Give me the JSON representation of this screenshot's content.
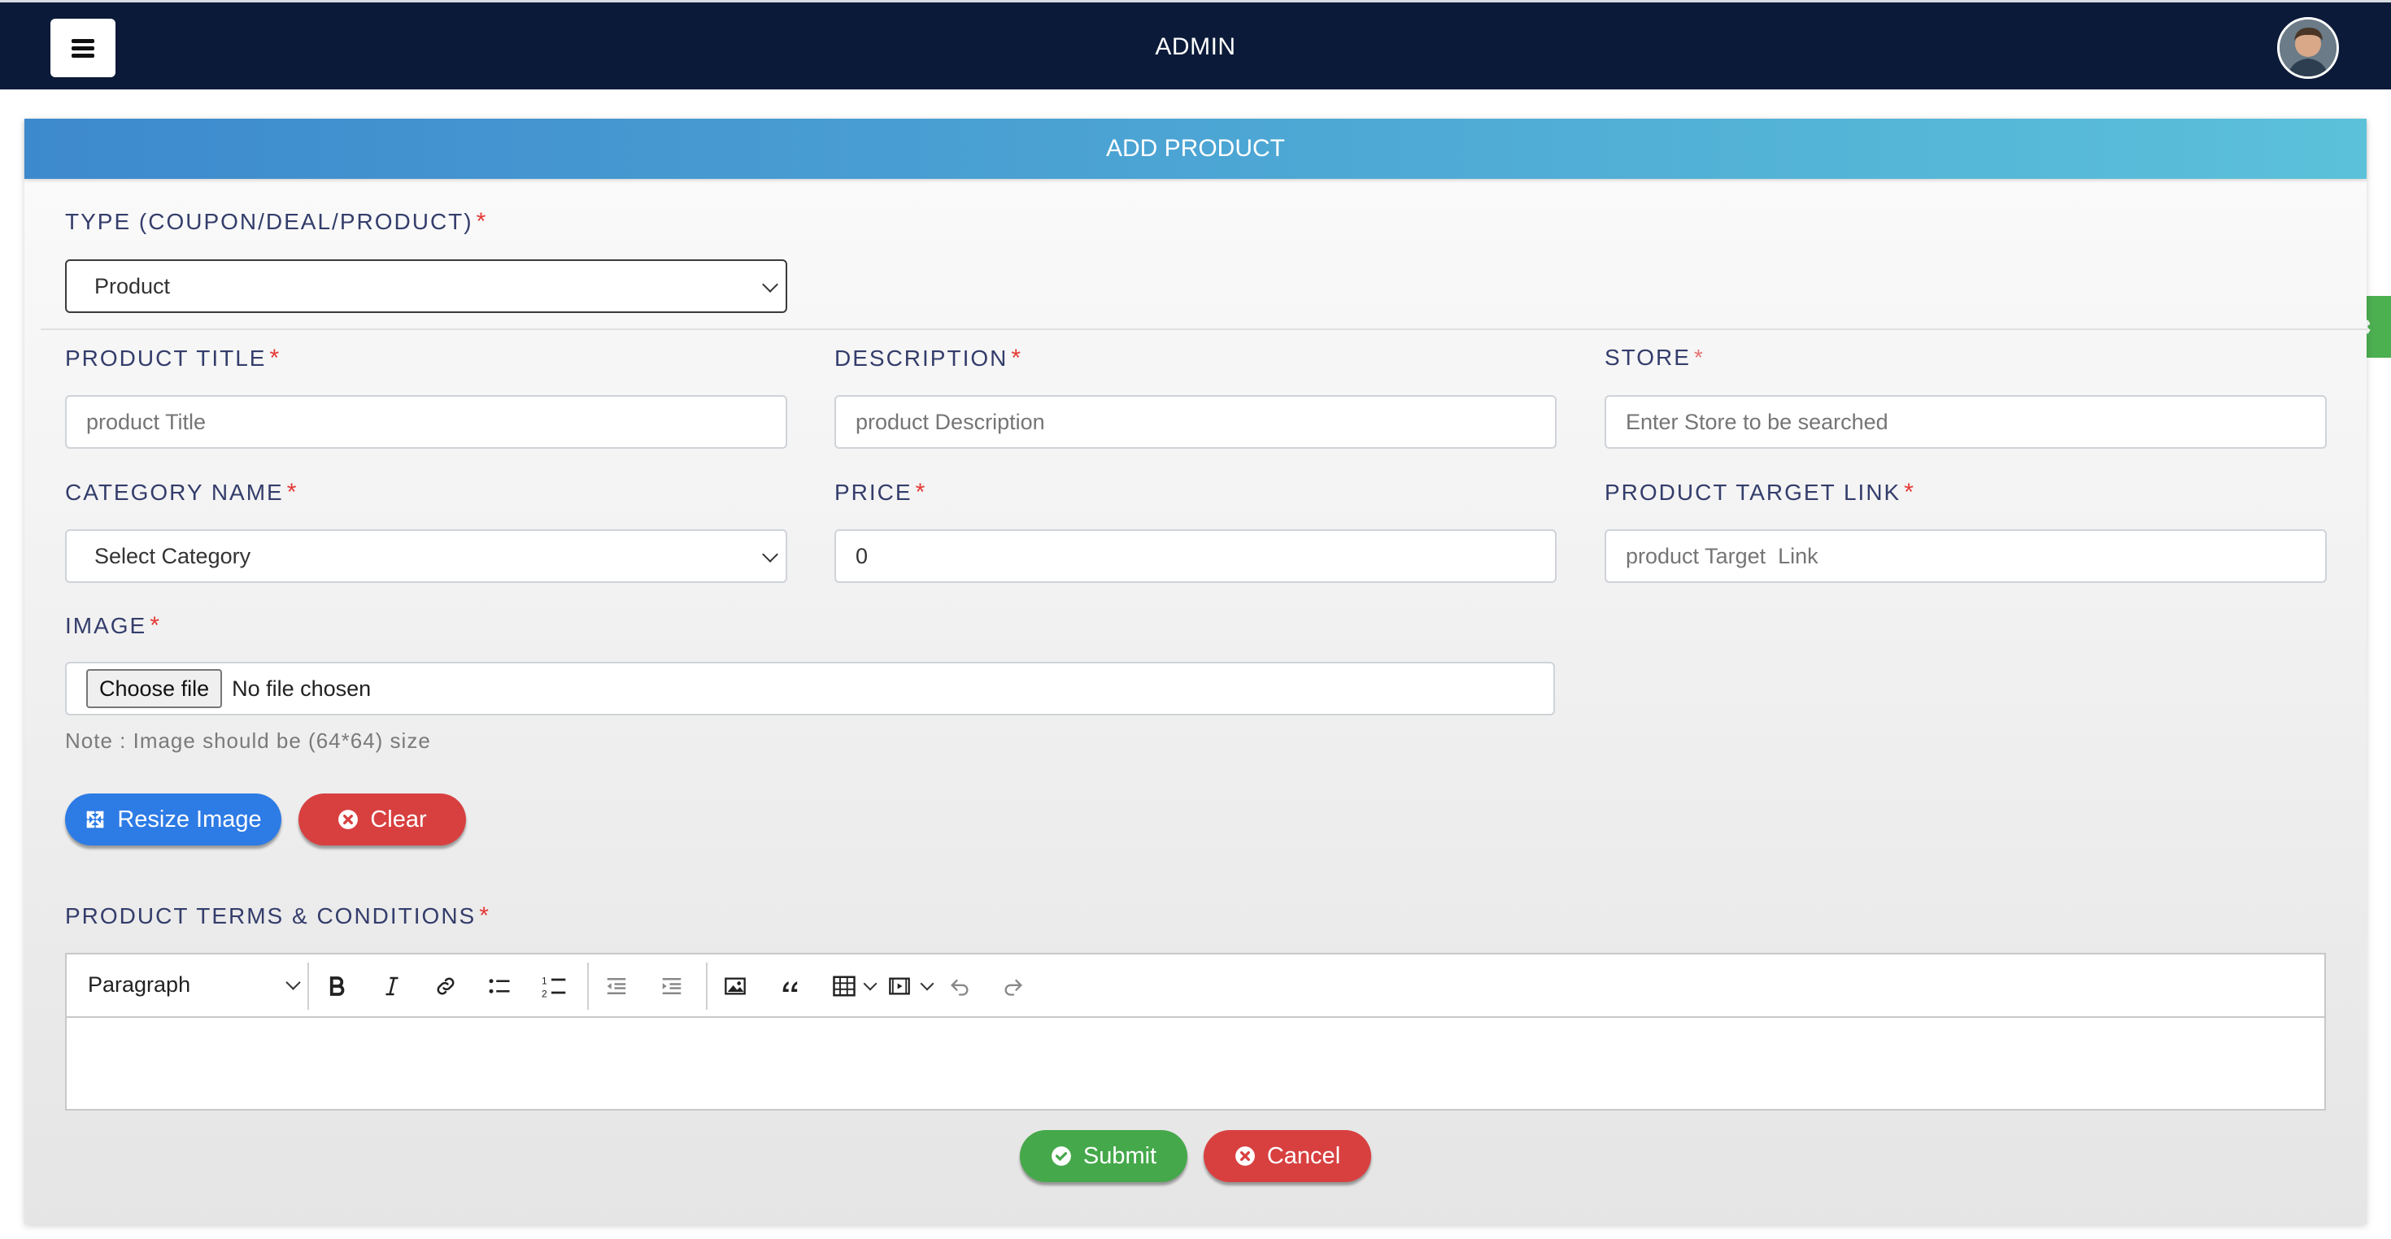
{
  "app": {
    "title": "ADMIN"
  },
  "form": {
    "header": "ADD PRODUCT",
    "type": {
      "label": "TYPE (COUPON/DEAL/PRODUCT)",
      "value": "Product"
    },
    "product_title": {
      "label": "PRODUCT TITLE",
      "placeholder": "product Title",
      "value": ""
    },
    "description": {
      "label": "DESCRIPTION",
      "placeholder": "product Description",
      "value": ""
    },
    "store": {
      "label": "STORE",
      "placeholder": "Enter Store to be searched",
      "value": ""
    },
    "category": {
      "label": "CATEGORY NAME",
      "value": "Select Category"
    },
    "price": {
      "label": "PRICE",
      "value": "0"
    },
    "target_link": {
      "label": "PRODUCT TARGET LINK",
      "placeholder": "product Target  Link",
      "value": ""
    },
    "image": {
      "label": "IMAGE",
      "choose_label": "Choose file",
      "status": "No file chosen",
      "note": "Note : Image should be (64*64) size"
    },
    "resize_label": "Resize Image",
    "clear_label": "Clear",
    "terms": {
      "label": "PRODUCT TERMS & CONDITIONS",
      "paragraph_label": "Paragraph"
    },
    "submit_label": "Submit",
    "cancel_label": "Cancel",
    "required_mark": "*"
  },
  "colors": {
    "topbar": "#0b1a38",
    "header_start": "#3d89cd",
    "header_end": "#5bc1da",
    "required": "#e53935",
    "blue_button": "#2d7be5",
    "red_button": "#d84040",
    "green_button": "#45a84a"
  },
  "icons": {
    "menu": "hamburger-icon",
    "settings": "gear-icon",
    "resize": "expand-arrows-icon",
    "clear": "circle-x-icon",
    "submit": "circle-check-icon",
    "cancel": "circle-x-icon"
  }
}
